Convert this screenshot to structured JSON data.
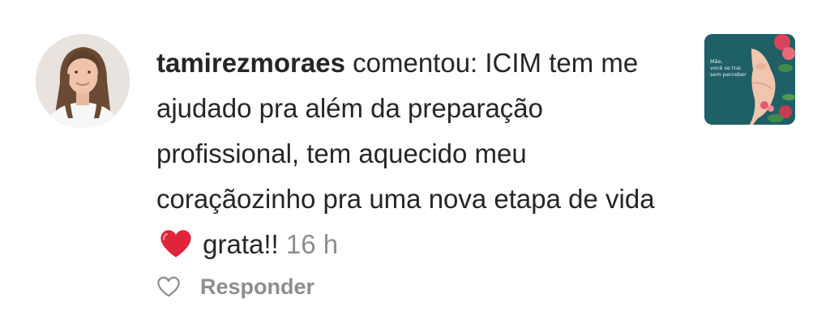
{
  "comment": {
    "username": "tamirezmoraes",
    "verb": "comentou:",
    "text_before_emoji": "ICIM tem me ajudado pra além da preparação profissional, tem aquecido meu coraçãozinho pra uma nova etapa de vida",
    "emoji": "red-heart",
    "text_after_emoji": "grata!!",
    "timestamp": "16 h"
  },
  "actions": {
    "like_icon": "heart-outline-icon",
    "reply_label": "Responder"
  },
  "post_thumbnail": {
    "line1": "Mãe,",
    "line2": "você se trai",
    "line3": "sem perceber"
  },
  "colors": {
    "text": "#262626",
    "secondary": "#8e8e8e",
    "heart": "#e0243a",
    "thumb_bg": "#1f5f66"
  }
}
